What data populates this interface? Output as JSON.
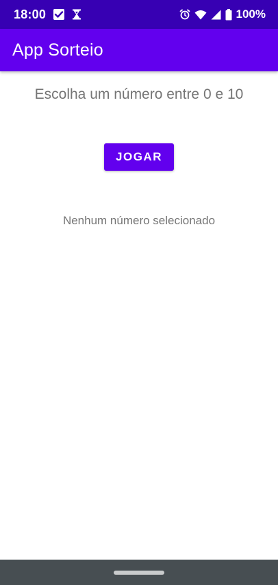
{
  "status_bar": {
    "time": "18:00",
    "battery_percent": "100%",
    "left_icons": [
      "checkbox-icon",
      "hourglass-icon"
    ],
    "right_icons": [
      "alarm-icon",
      "wifi-icon",
      "signal-icon",
      "battery-icon"
    ]
  },
  "app_bar": {
    "title": "App Sorteio"
  },
  "main": {
    "instruction": "Escolha um número entre 0 e 10",
    "play_button_label": "JOGAR",
    "result_text": "Nenhum número selecionado"
  },
  "colors": {
    "status_bar": "#3700B3",
    "primary": "#6200EE",
    "text_secondary": "#757575",
    "nav_bar": "#474E52"
  }
}
